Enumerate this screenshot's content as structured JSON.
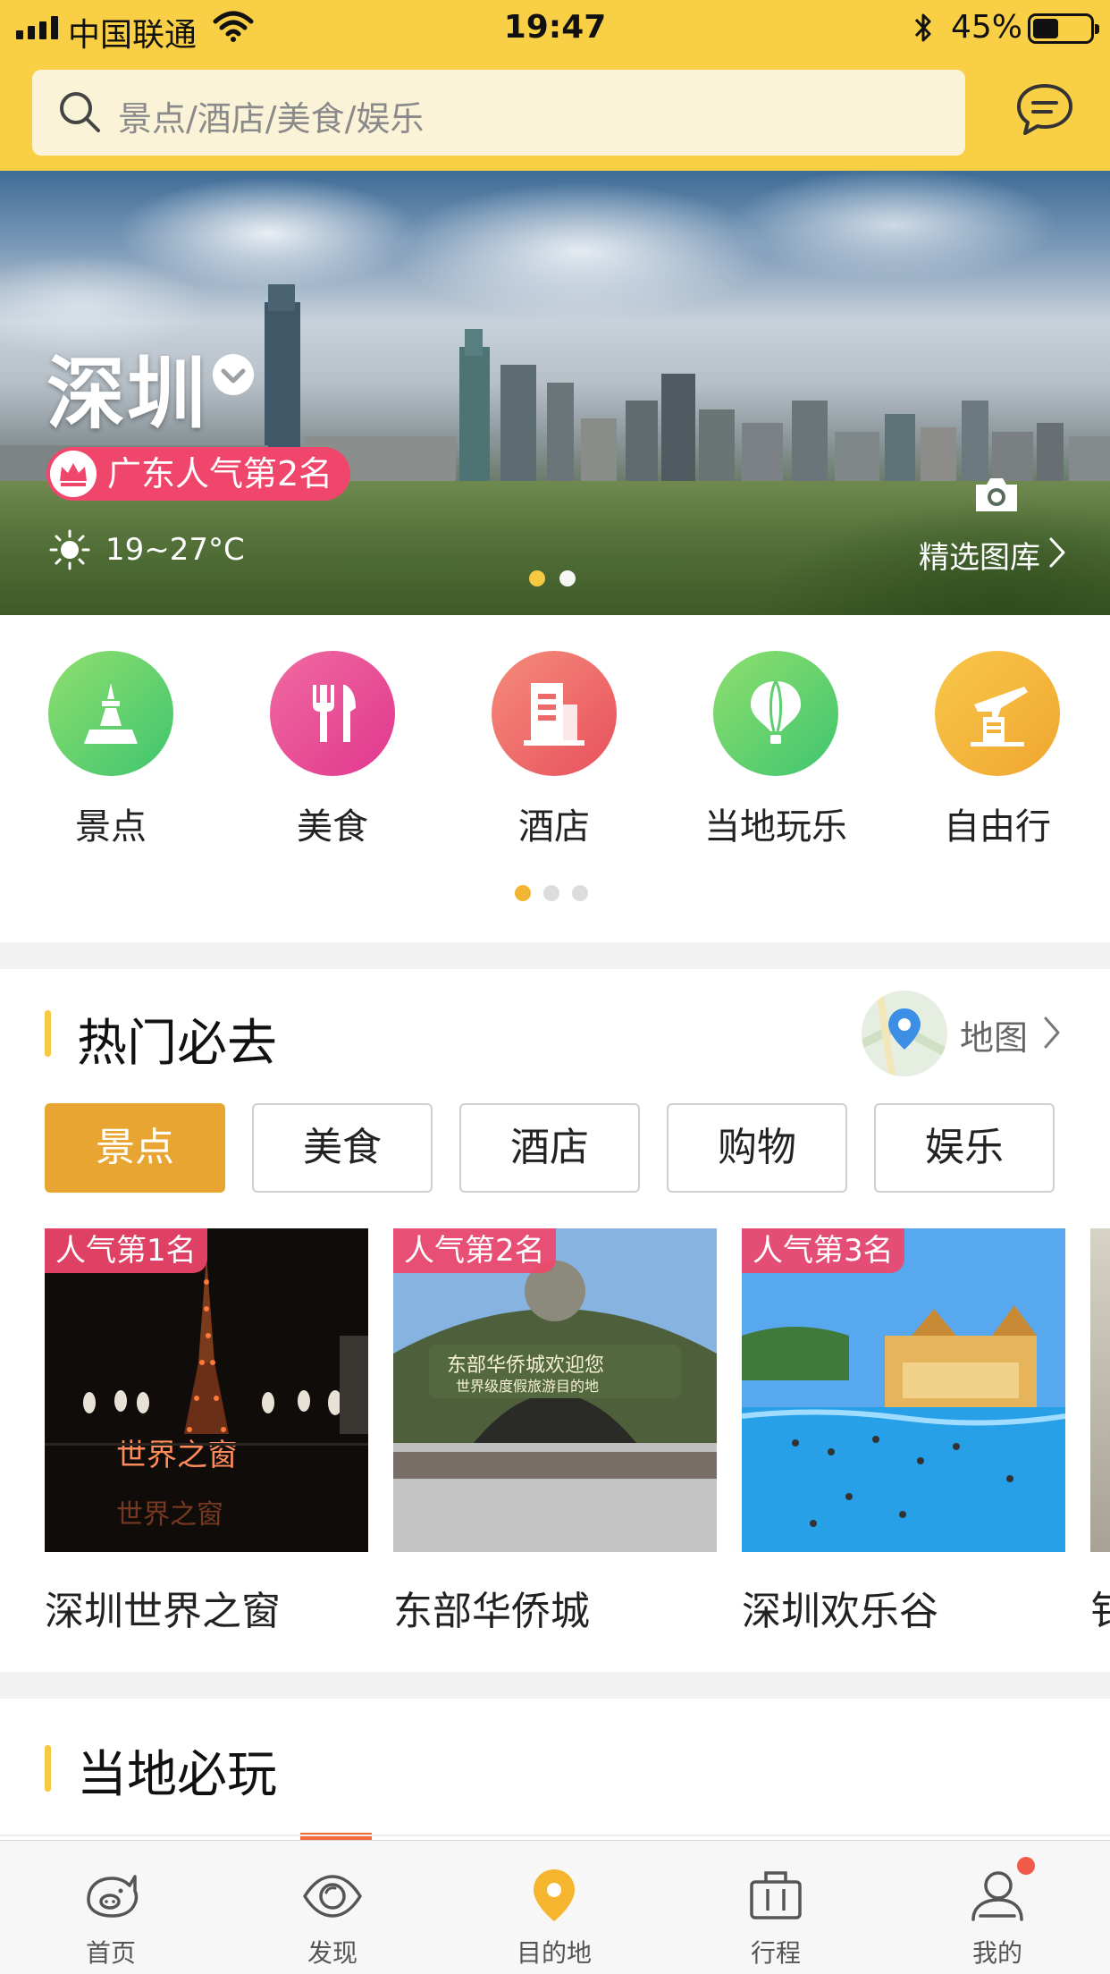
{
  "status_bar": {
    "carrier": "中国联通",
    "time": "19:47",
    "battery_percent": "45%",
    "battery_level": 0.45
  },
  "search": {
    "placeholder": "景点/酒店/美食/娱乐"
  },
  "banner": {
    "city": "深圳",
    "rank_badge": "广东人气第2名",
    "weather": "19~27°C",
    "gallery_label": "精选图库",
    "slide_count": 2,
    "active_slide": 1
  },
  "categories": [
    {
      "label": "景点",
      "icon": "tower-icon",
      "color_from": "#8fdf6e",
      "color_to": "#3fc56f"
    },
    {
      "label": "美食",
      "icon": "fork-knife-icon",
      "color_from": "#f06aa0",
      "color_to": "#e1378e"
    },
    {
      "label": "酒店",
      "icon": "hotel-icon",
      "color_from": "#f58c7a",
      "color_to": "#e8505d"
    },
    {
      "label": "当地玩乐",
      "icon": "balloon-icon",
      "color_from": "#8fdf6e",
      "color_to": "#3fc56f"
    },
    {
      "label": "自由行",
      "icon": "plane-icon",
      "color_from": "#f8c74a",
      "color_to": "#f0a630"
    }
  ],
  "category_pages": {
    "count": 3,
    "active": 1
  },
  "hot": {
    "title": "热门必去",
    "map_label": "地图",
    "tabs": [
      "景点",
      "美食",
      "酒店",
      "购物",
      "娱乐"
    ],
    "active_tab": 0,
    "cards": [
      {
        "rank": "人气第1名",
        "name": "深圳世界之窗"
      },
      {
        "rank": "人气第2名",
        "name": "东部华侨城"
      },
      {
        "rank": "人气第3名",
        "name": "深圳欢乐谷"
      },
      {
        "rank": "",
        "name": "钅"
      }
    ]
  },
  "local": {
    "title": "当地必玩"
  },
  "tabbar": [
    {
      "label": "首页",
      "icon": "pig-icon"
    },
    {
      "label": "发现",
      "icon": "eye-icon"
    },
    {
      "label": "目的地",
      "icon": "location-pin-icon"
    },
    {
      "label": "行程",
      "icon": "suitcase-icon"
    },
    {
      "label": "我的",
      "icon": "person-icon"
    }
  ],
  "colors": {
    "header_yellow": "#f9cf45",
    "accent_orange": "#e9a531",
    "rank_pink": "#f0466b",
    "section_bar": "#f7c943"
  }
}
